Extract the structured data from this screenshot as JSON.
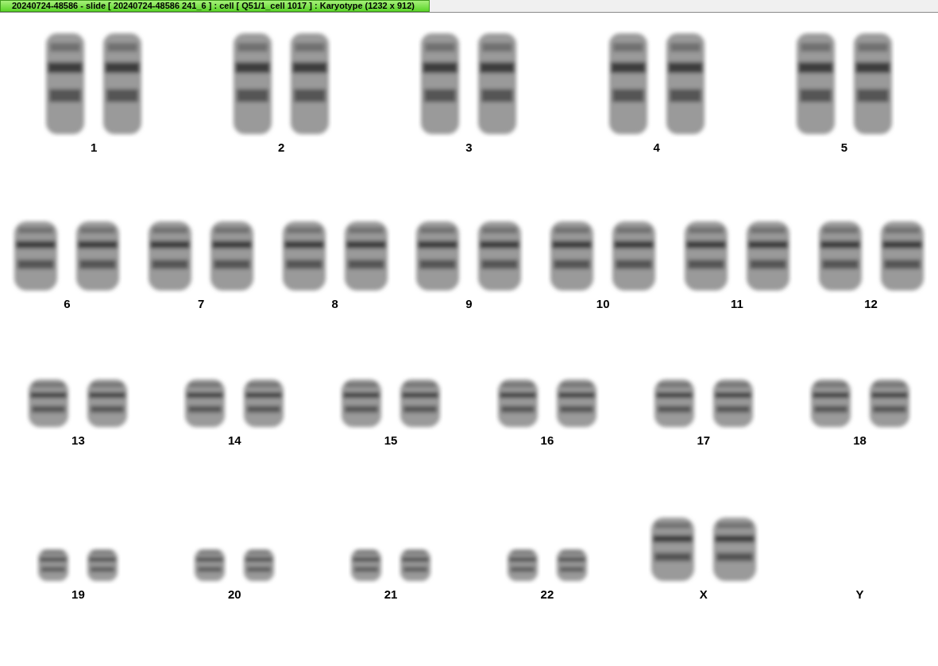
{
  "window": {
    "title": "20240724-48586 - slide [ 20240724-48586 241_6 ] : cell [ Q51/1_cell 1017 ] : Karyotype  (1232 x 912)"
  },
  "karyotype": {
    "rows": [
      {
        "groups": [
          {
            "label": "1",
            "kind": "pair"
          },
          {
            "label": "2",
            "kind": "pair"
          },
          {
            "label": "3",
            "kind": "pair"
          },
          {
            "label": "4",
            "kind": "pair"
          },
          {
            "label": "5",
            "kind": "pair"
          }
        ]
      },
      {
        "groups": [
          {
            "label": "6",
            "kind": "pair"
          },
          {
            "label": "7",
            "kind": "pair"
          },
          {
            "label": "8",
            "kind": "pair"
          },
          {
            "label": "9",
            "kind": "pair"
          },
          {
            "label": "10",
            "kind": "pair"
          },
          {
            "label": "11",
            "kind": "pair"
          },
          {
            "label": "12",
            "kind": "pair"
          }
        ]
      },
      {
        "groups": [
          {
            "label": "13",
            "kind": "pair"
          },
          {
            "label": "14",
            "kind": "pair"
          },
          {
            "label": "15",
            "kind": "pair"
          },
          {
            "label": "16",
            "kind": "pair"
          },
          {
            "label": "17",
            "kind": "pair"
          },
          {
            "label": "18",
            "kind": "pair"
          }
        ]
      },
      {
        "groups": [
          {
            "label": "19",
            "kind": "pair"
          },
          {
            "label": "20",
            "kind": "pair"
          },
          {
            "label": "21",
            "kind": "pair"
          },
          {
            "label": "22",
            "kind": "pair"
          },
          {
            "label": "X",
            "kind": "pair"
          },
          {
            "label": "Y",
            "kind": "empty"
          }
        ]
      }
    ]
  }
}
